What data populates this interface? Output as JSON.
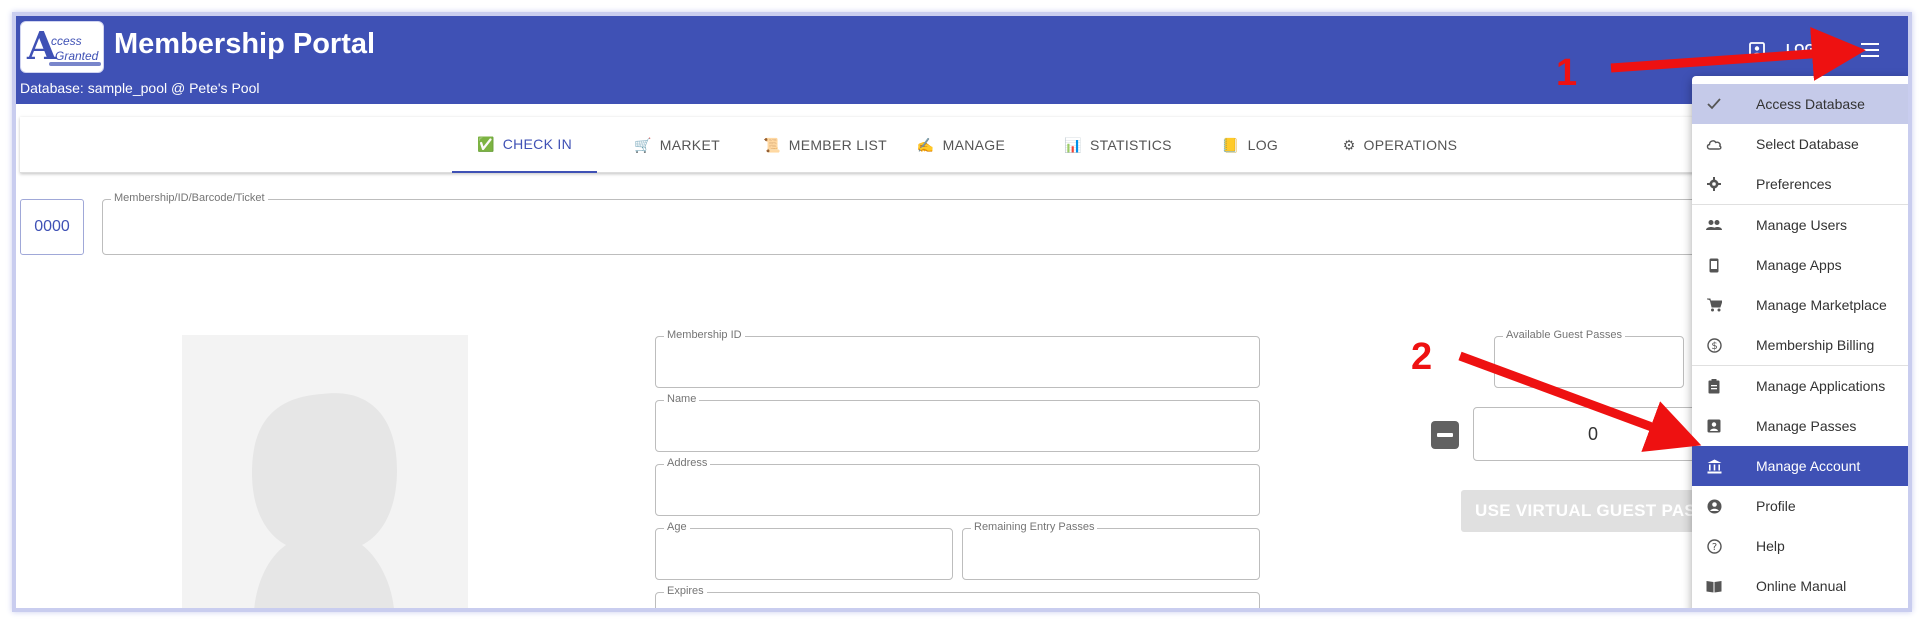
{
  "header": {
    "logo_big": "A",
    "logo_line1": "ccess",
    "logo_line2": "Granted",
    "title": "Membership Portal",
    "database_line": "Database: sample_pool @ Pete's Pool",
    "logout_label": "LOGOU",
    "brand_color": "#3f51b5"
  },
  "tabs": [
    {
      "label": "CHECK IN",
      "icon": "✅",
      "active": true
    },
    {
      "label": "MARKET",
      "icon": "🛒"
    },
    {
      "label": "MEMBER LIST",
      "icon": "📜"
    },
    {
      "label": "MANAGE",
      "icon": "✍"
    },
    {
      "label": "STATISTICS",
      "icon": "📊"
    },
    {
      "label": "LOG",
      "icon": "📒"
    },
    {
      "label": "OPERATIONS",
      "icon": "⚙"
    }
  ],
  "checkin": {
    "code": "0000",
    "search_label": "Membership/ID/Barcode/Ticket",
    "membership_id_label": "Membership ID",
    "name_label": "Name",
    "address_label": "Address",
    "age_label": "Age",
    "remaining_label": "Remaining Entry Passes",
    "expires_label": "Expires",
    "guest_passes_label": "Available Guest Passes",
    "guest_count": "0",
    "use_guest_button": "USE VIRTUAL GUEST PASSES"
  },
  "menu": {
    "items": [
      {
        "label": "Access Database",
        "icon": "check-icon"
      },
      {
        "label": "Select Database",
        "icon": "cloud-icon"
      },
      {
        "label": "Preferences",
        "icon": "gear-icon"
      },
      {
        "label": "Manage Users",
        "icon": "people-icon"
      },
      {
        "label": "Manage Apps",
        "icon": "phone-icon"
      },
      {
        "label": "Manage Marketplace",
        "icon": "cart-icon"
      },
      {
        "label": "Membership Billing",
        "icon": "dollar-icon"
      },
      {
        "label": "Manage Applications",
        "icon": "clipboard-icon"
      },
      {
        "label": "Manage Passes",
        "icon": "badge-icon"
      },
      {
        "label": "Manage Account",
        "icon": "bank-icon"
      },
      {
        "label": "Profile",
        "icon": "account-circle-icon"
      },
      {
        "label": "Help",
        "icon": "help-icon"
      },
      {
        "label": "Online Manual",
        "icon": "book-icon"
      }
    ]
  },
  "annotations": {
    "step1": "1",
    "step2": "2",
    "color": "#ee1111"
  }
}
